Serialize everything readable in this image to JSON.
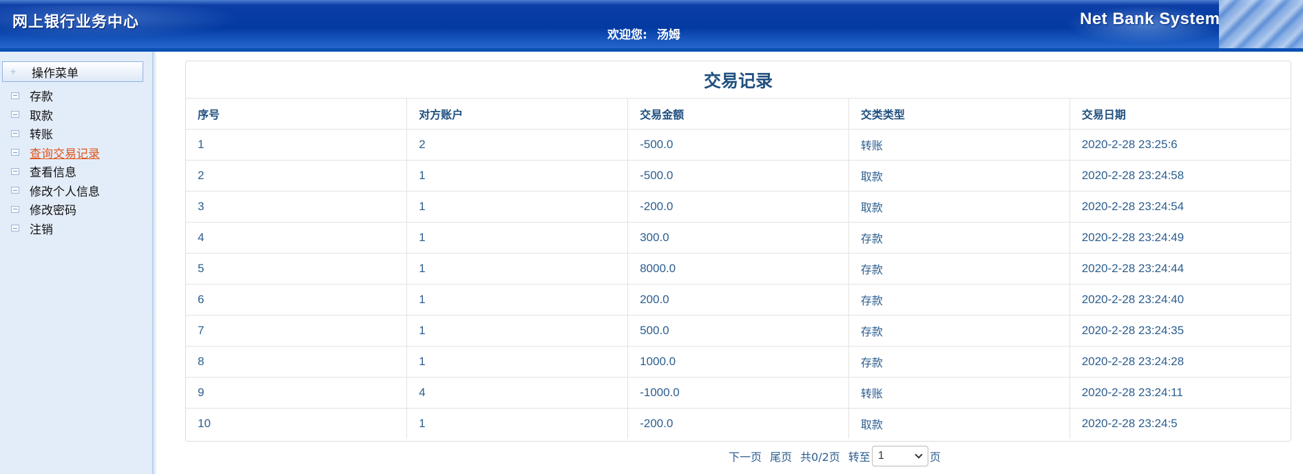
{
  "header": {
    "app_title": "网上银行业务中心",
    "welcome_label": "欢迎您:",
    "user_name": "汤姆",
    "brand": "Net Bank System"
  },
  "sidebar": {
    "menu_title": "操作菜单",
    "items": [
      {
        "label": "存款",
        "active": false
      },
      {
        "label": "取款",
        "active": false
      },
      {
        "label": "转账",
        "active": false
      },
      {
        "label": "查询交易记录",
        "active": true
      },
      {
        "label": "查看信息",
        "active": false
      },
      {
        "label": "修改个人信息",
        "active": false
      },
      {
        "label": "修改密码",
        "active": false
      },
      {
        "label": "注销",
        "active": false
      }
    ]
  },
  "main": {
    "title": "交易记录",
    "columns": [
      "序号",
      "对方账户",
      "交易金额",
      "交类类型",
      "交易日期"
    ],
    "rows": [
      [
        "1",
        "2",
        "-500.0",
        "转账",
        "2020-2-28 23:25:6"
      ],
      [
        "2",
        "1",
        "-500.0",
        "取款",
        "2020-2-28 23:24:58"
      ],
      [
        "3",
        "1",
        "-200.0",
        "取款",
        "2020-2-28 23:24:54"
      ],
      [
        "4",
        "1",
        "300.0",
        "存款",
        "2020-2-28 23:24:49"
      ],
      [
        "5",
        "1",
        "8000.0",
        "存款",
        "2020-2-28 23:24:44"
      ],
      [
        "6",
        "1",
        "200.0",
        "存款",
        "2020-2-28 23:24:40"
      ],
      [
        "7",
        "1",
        "500.0",
        "存款",
        "2020-2-28 23:24:35"
      ],
      [
        "8",
        "1",
        "1000.0",
        "存款",
        "2020-2-28 23:24:28"
      ],
      [
        "9",
        "4",
        "-1000.0",
        "转账",
        "2020-2-28 23:24:11"
      ],
      [
        "10",
        "1",
        "-200.0",
        "取款",
        "2020-2-28 23:24:5"
      ]
    ]
  },
  "pager": {
    "next_label": "下一页",
    "last_label": "尾页",
    "page_info": "共0/2页",
    "goto_label": "转至",
    "selected_page": "1",
    "page_suffix": "页"
  },
  "colors": {
    "header_blue": "#023aa2",
    "table_text": "#2b5d8f",
    "active_link": "#e0541b",
    "sidebar_bg": "#e3edf9"
  }
}
